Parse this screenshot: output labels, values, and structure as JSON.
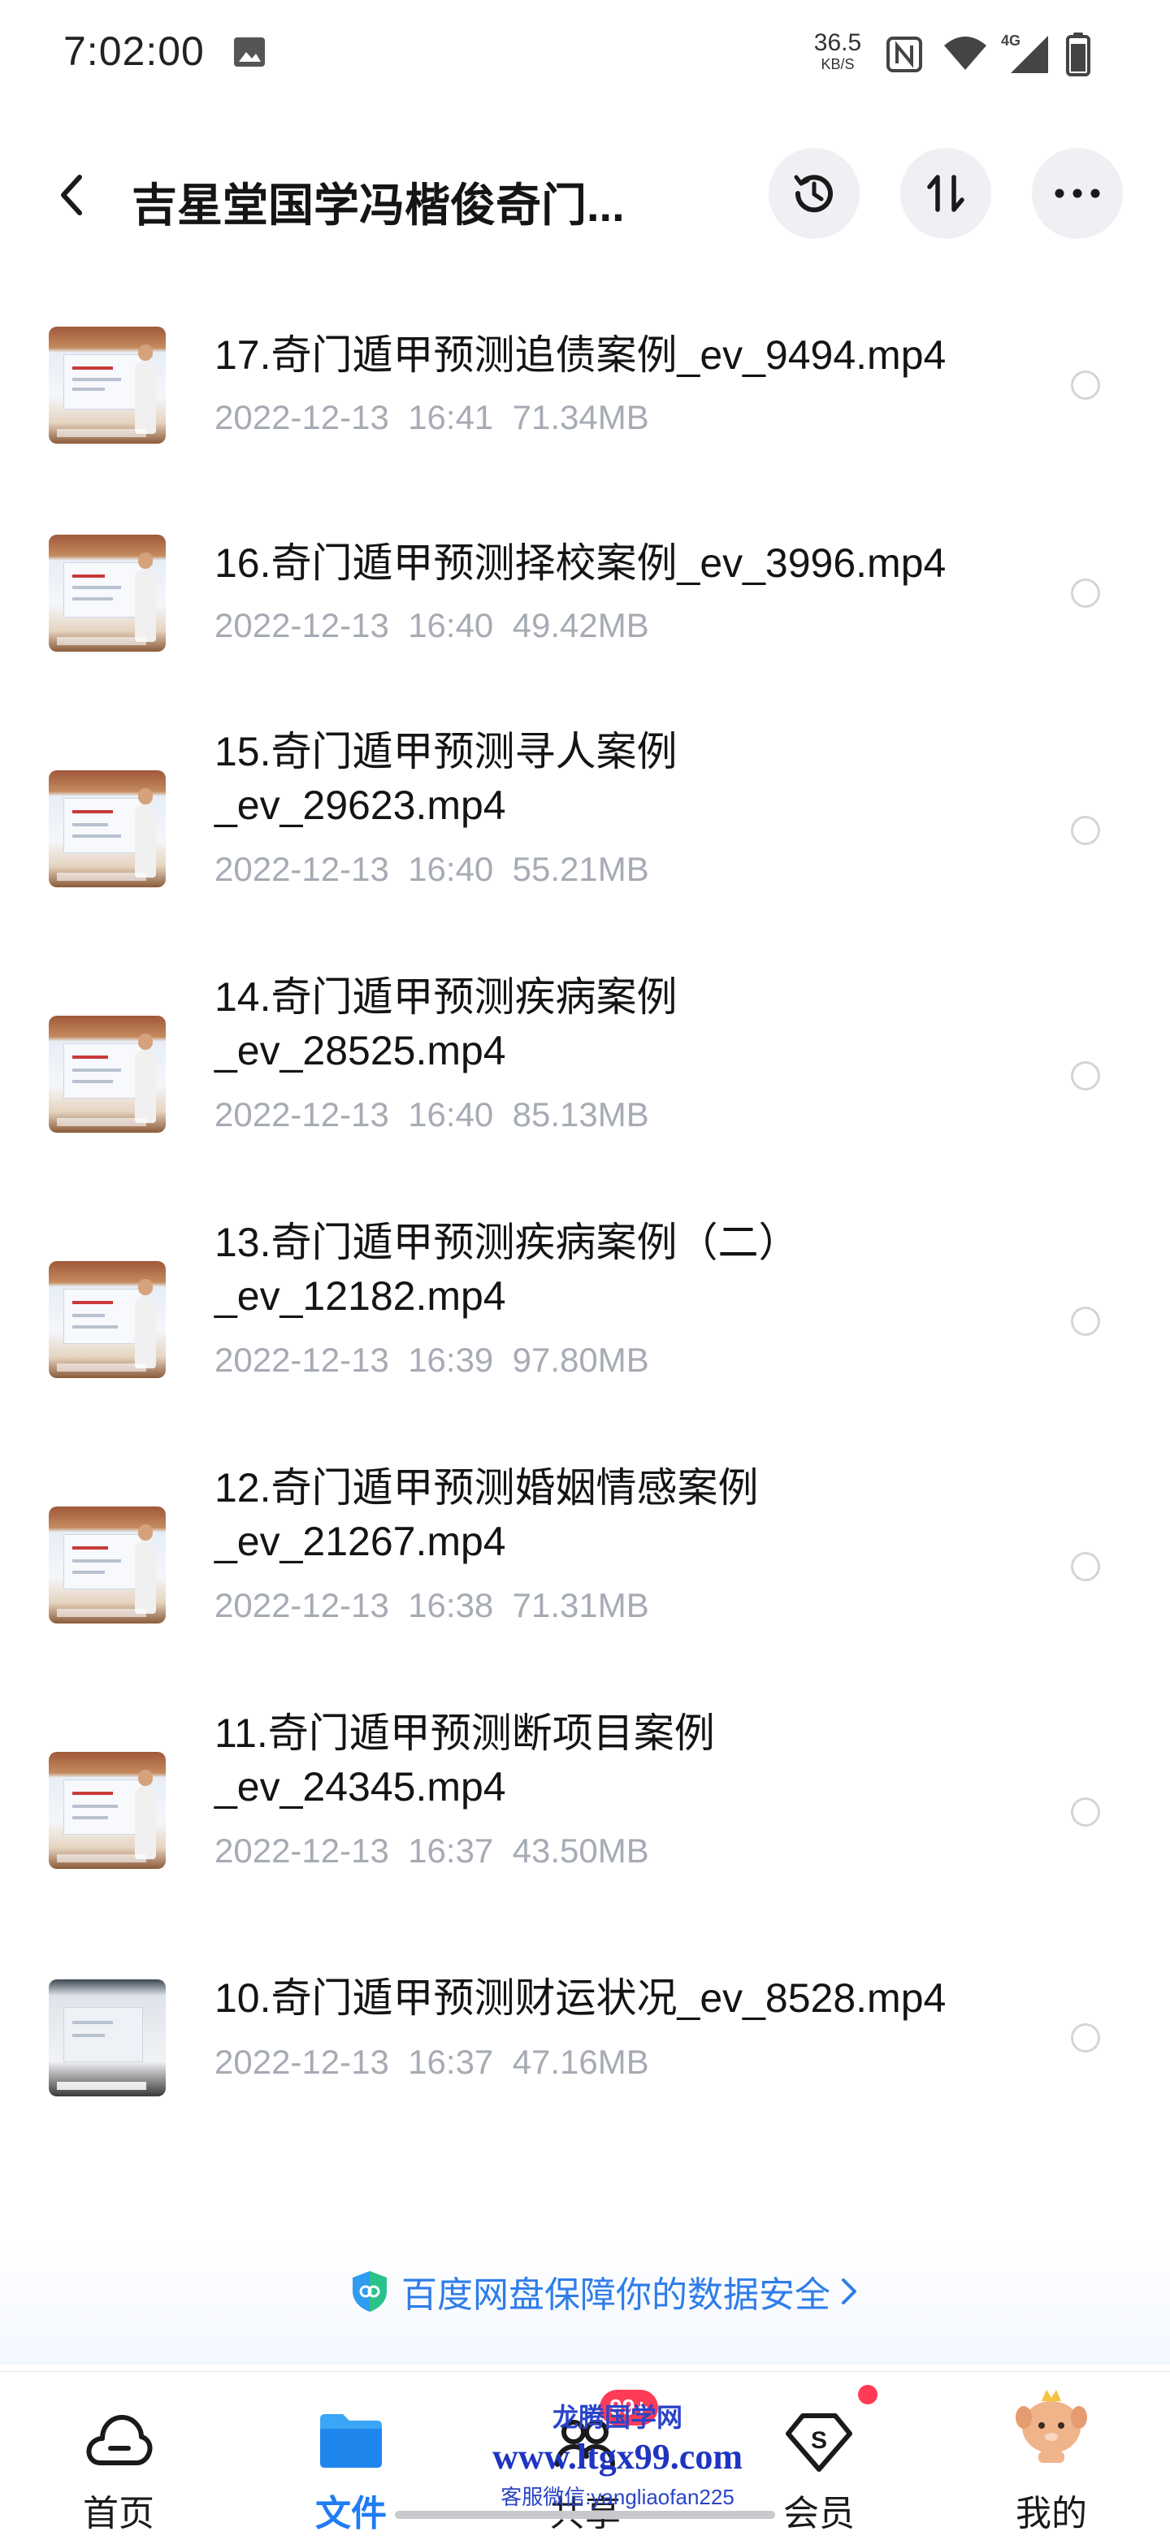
{
  "status_bar": {
    "time": "7:02:00",
    "net_speed": "36.5",
    "net_speed_unit": "KB/S",
    "network_type": "4G"
  },
  "header": {
    "title": "吉星堂国学冯楷俊奇门...",
    "back_icon": "chevron-left-icon",
    "history_icon": "history-clock-icon",
    "sort_icon": "sort-updown-icon",
    "more_icon": "more-dots-icon"
  },
  "files": [
    {
      "name": "17.奇门遁甲预测追债案例_ev_9494.mp4",
      "date": "2022-12-13",
      "time": "16:41",
      "size": "71.34MB"
    },
    {
      "name": "16.奇门遁甲预测择校案例_ev_3996.mp4",
      "date": "2022-12-13",
      "time": "16:40",
      "size": "49.42MB"
    },
    {
      "name": "15.奇门遁甲预测寻人案例\n_ev_29623.mp4",
      "date": "2022-12-13",
      "time": "16:40",
      "size": "55.21MB"
    },
    {
      "name": "14.奇门遁甲预测疾病案例\n_ev_28525.mp4",
      "date": "2022-12-13",
      "time": "16:40",
      "size": "85.13MB"
    },
    {
      "name": "13.奇门遁甲预测疾病案例（二）\n_ev_12182.mp4",
      "date": "2022-12-13",
      "time": "16:39",
      "size": "97.80MB"
    },
    {
      "name": "12.奇门遁甲预测婚姻情感案例\n_ev_21267.mp4",
      "date": "2022-12-13",
      "time": "16:38",
      "size": "71.31MB"
    },
    {
      "name": "11.奇门遁甲预测断项目案例\n_ev_24345.mp4",
      "date": "2022-12-13",
      "time": "16:37",
      "size": "43.50MB"
    },
    {
      "name": "10.奇门遁甲预测财运状况_ev_8528.mp4",
      "date": "2022-12-13",
      "time": "16:37",
      "size": "47.16MB"
    }
  ],
  "security_banner": {
    "text": "百度网盘保障你的数据安全",
    "icon": "shield-icon"
  },
  "bottom_nav": {
    "items": [
      {
        "label": "首页",
        "icon": "cloud-home-icon"
      },
      {
        "label": "文件",
        "icon": "folder-icon",
        "active": true
      },
      {
        "label": "共享",
        "icon": "share-icon",
        "badge": "99+"
      },
      {
        "label": "会员",
        "icon": "vip-s-icon"
      },
      {
        "label": "我的",
        "icon": "avatar-icon"
      }
    ]
  },
  "watermark": {
    "line1": "龙腾国学网",
    "line2": "www.ltgx99.com",
    "line3": "客服微信:yangliaofan225"
  },
  "colors": {
    "accent": "#1f7cf3",
    "meta_text": "#a6abb4",
    "badge": "#ff3b55"
  }
}
